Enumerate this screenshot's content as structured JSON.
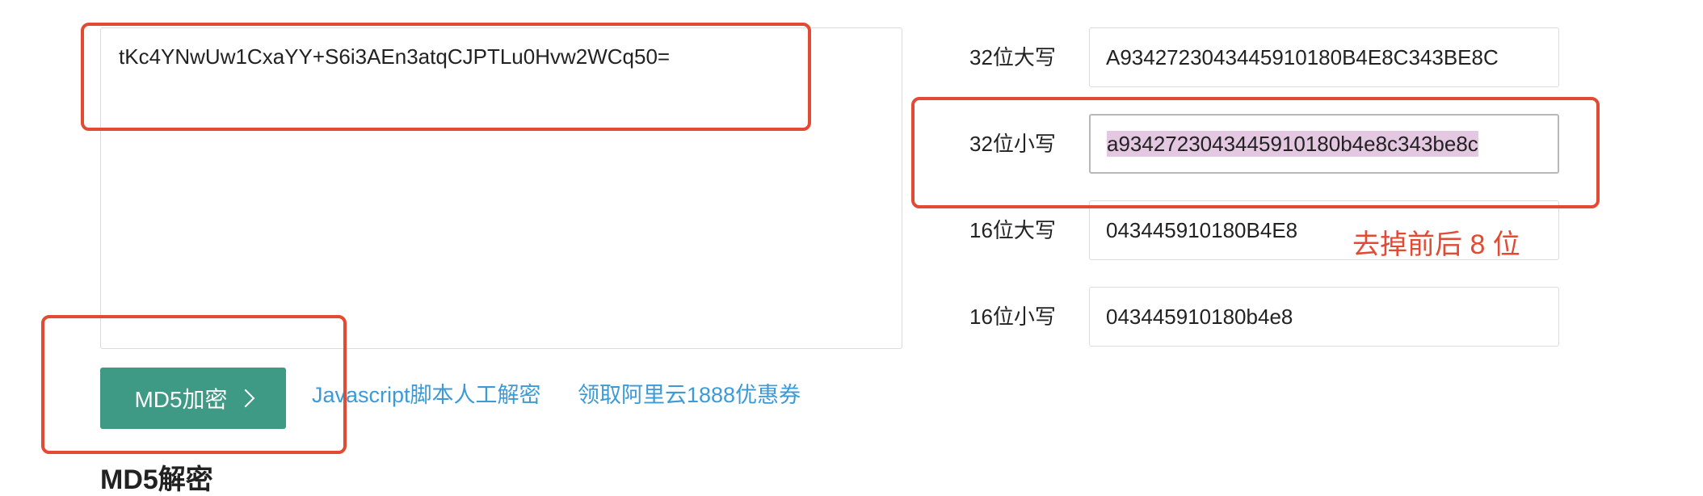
{
  "input": {
    "text": "tKc4YNwUw1CxaYY+S6i3AEn3atqCJPTLu0Hvw2WCq50="
  },
  "actions": {
    "encrypt_label": "MD5加密",
    "link_js": "Javascript脚本人工解密",
    "link_aliyun": "领取阿里云1888优惠券"
  },
  "next_section": {
    "heading": "MD5解密"
  },
  "results": [
    {
      "label": "32位大写",
      "value": "A9342723043445910180B4E8C343BE8C"
    },
    {
      "label": "32位小写",
      "value": "a9342723043445910180b4e8c343be8c"
    },
    {
      "label": "16位大写",
      "value": "043445910180B4E8"
    },
    {
      "label": "16位小写",
      "value": "043445910180b4e8"
    }
  ],
  "annotation": {
    "note": "去掉前后 8 位",
    "color": "#e24a33"
  },
  "colors": {
    "button": "#3f9a85",
    "link": "#3c9ad6",
    "selection": "#e4c8e2"
  }
}
